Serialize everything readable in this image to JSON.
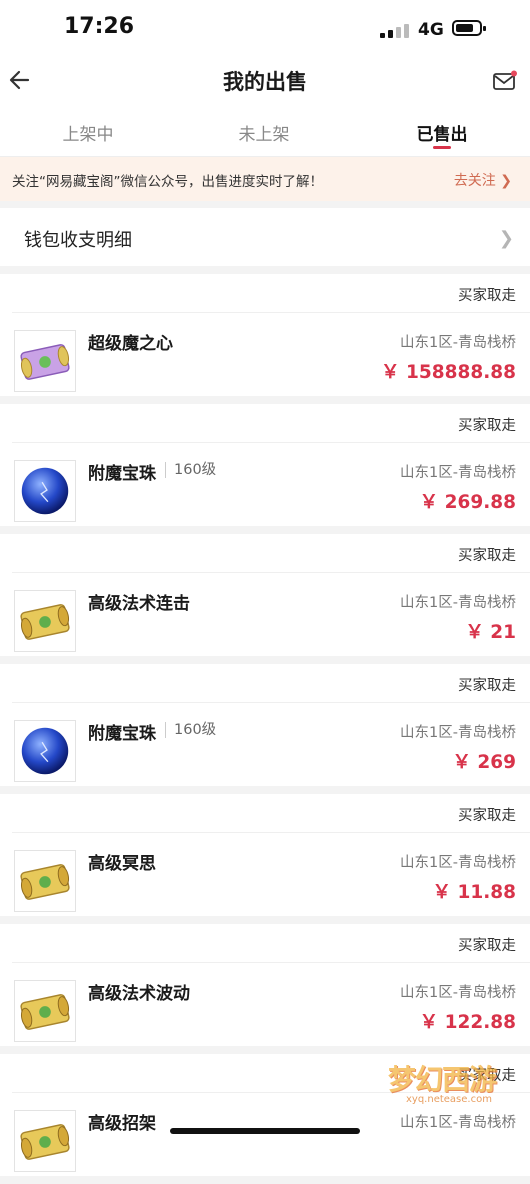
{
  "status_bar": {
    "time": "17:26",
    "network": "4G"
  },
  "header": {
    "title": "我的出售"
  },
  "tabs": [
    {
      "label": "上架中",
      "active": false
    },
    {
      "label": "未上架",
      "active": false
    },
    {
      "label": "已售出",
      "active": true
    }
  ],
  "notice": {
    "text": "关注“网易藏宝阁”微信公众号，出售进度实时了解！",
    "link": "去关注 ❯"
  },
  "wallet": {
    "label": "钱包收支明细"
  },
  "orders": [
    {
      "status": "买家取走",
      "name": "超级魔之心",
      "level": "",
      "server": "山东1区-青岛栈桥",
      "price": "￥ 158888.88",
      "icon": "scroll-purple-icon"
    },
    {
      "status": "买家取走",
      "name": "附魔宝珠",
      "level": "160级",
      "server": "山东1区-青岛栈桥",
      "price": "￥ 269.88",
      "icon": "blue-orb-icon"
    },
    {
      "status": "买家取走",
      "name": "高级法术连击",
      "level": "",
      "server": "山东1区-青岛栈桥",
      "price": "￥ 21",
      "icon": "scroll-gold-icon"
    },
    {
      "status": "买家取走",
      "name": "附魔宝珠",
      "level": "160级",
      "server": "山东1区-青岛栈桥",
      "price": "￥ 269",
      "icon": "blue-orb-icon"
    },
    {
      "status": "买家取走",
      "name": "高级冥思",
      "level": "",
      "server": "山东1区-青岛栈桥",
      "price": "￥ 11.88",
      "icon": "scroll-gold-icon"
    },
    {
      "status": "买家取走",
      "name": "高级法术波动",
      "level": "",
      "server": "山东1区-青岛栈桥",
      "price": "￥ 122.88",
      "icon": "scroll-gold-icon"
    },
    {
      "status": "买家取走",
      "name": "高级招架",
      "level": "",
      "server": "山东1区-青岛栈桥",
      "price": "",
      "icon": "scroll-gold-icon"
    }
  ],
  "watermark": {
    "logo": "梦幻西游",
    "url": "xyq.netease.com"
  },
  "colors": {
    "accent": "#d8334a",
    "notice_bg": "#fdf2ea",
    "link": "#d06b52"
  }
}
